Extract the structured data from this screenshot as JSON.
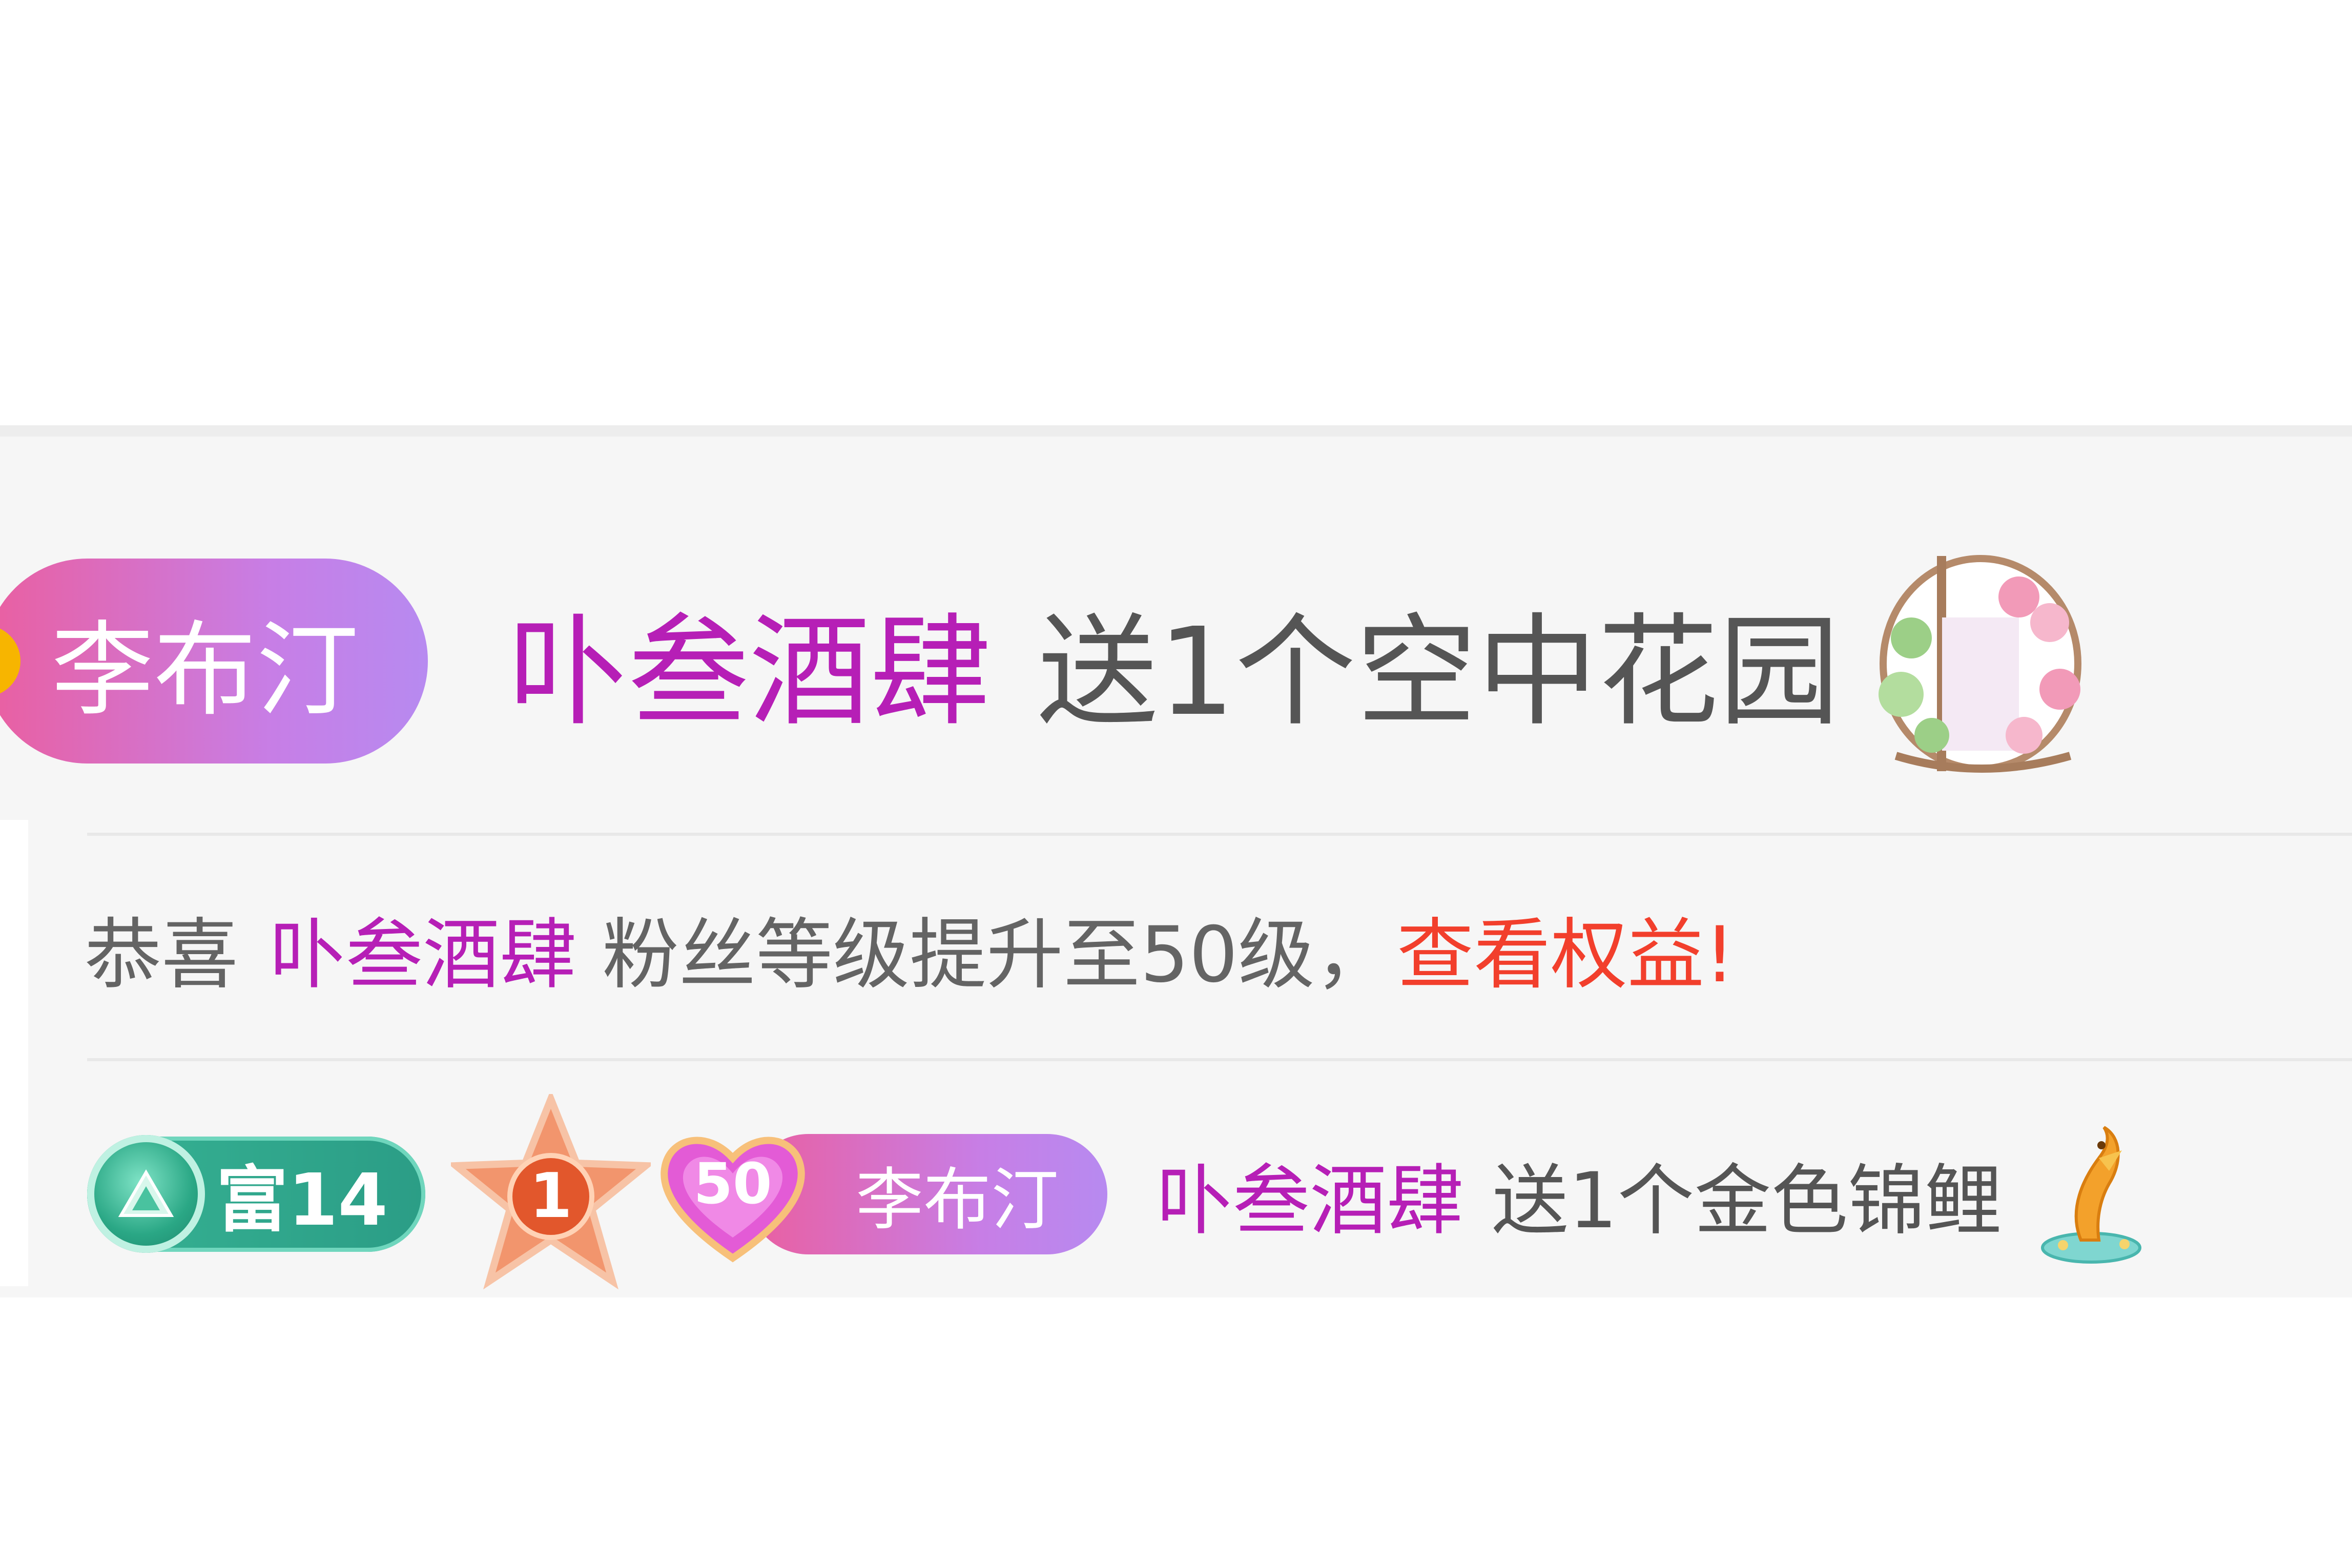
{
  "message_1": {
    "badge_name": "李布汀",
    "sender": "卟叁酒肆",
    "gift_text": "送1个空中花园",
    "gift_icon": "sky-garden-gift-icon"
  },
  "message_2": {
    "prefix": "恭喜",
    "user": "卟叁酒肆",
    "text": "粉丝等级提升至50级，",
    "link": "查看权益!"
  },
  "message_3": {
    "rich_badge": "富14",
    "star_level": "1",
    "fan_level": "50",
    "badge_name": "李布汀",
    "sender": "卟叁酒肆",
    "gift_text": "送1个金色锦鲤",
    "gift_icon": "golden-koi-gift-icon"
  },
  "colors": {
    "sender": "#b61fb6",
    "highlight_link": "#f23f2c",
    "pill_gradient_start": "#ea5fa0",
    "pill_gradient_end": "#b78af0",
    "panel_bg": "#f6f6f6"
  }
}
